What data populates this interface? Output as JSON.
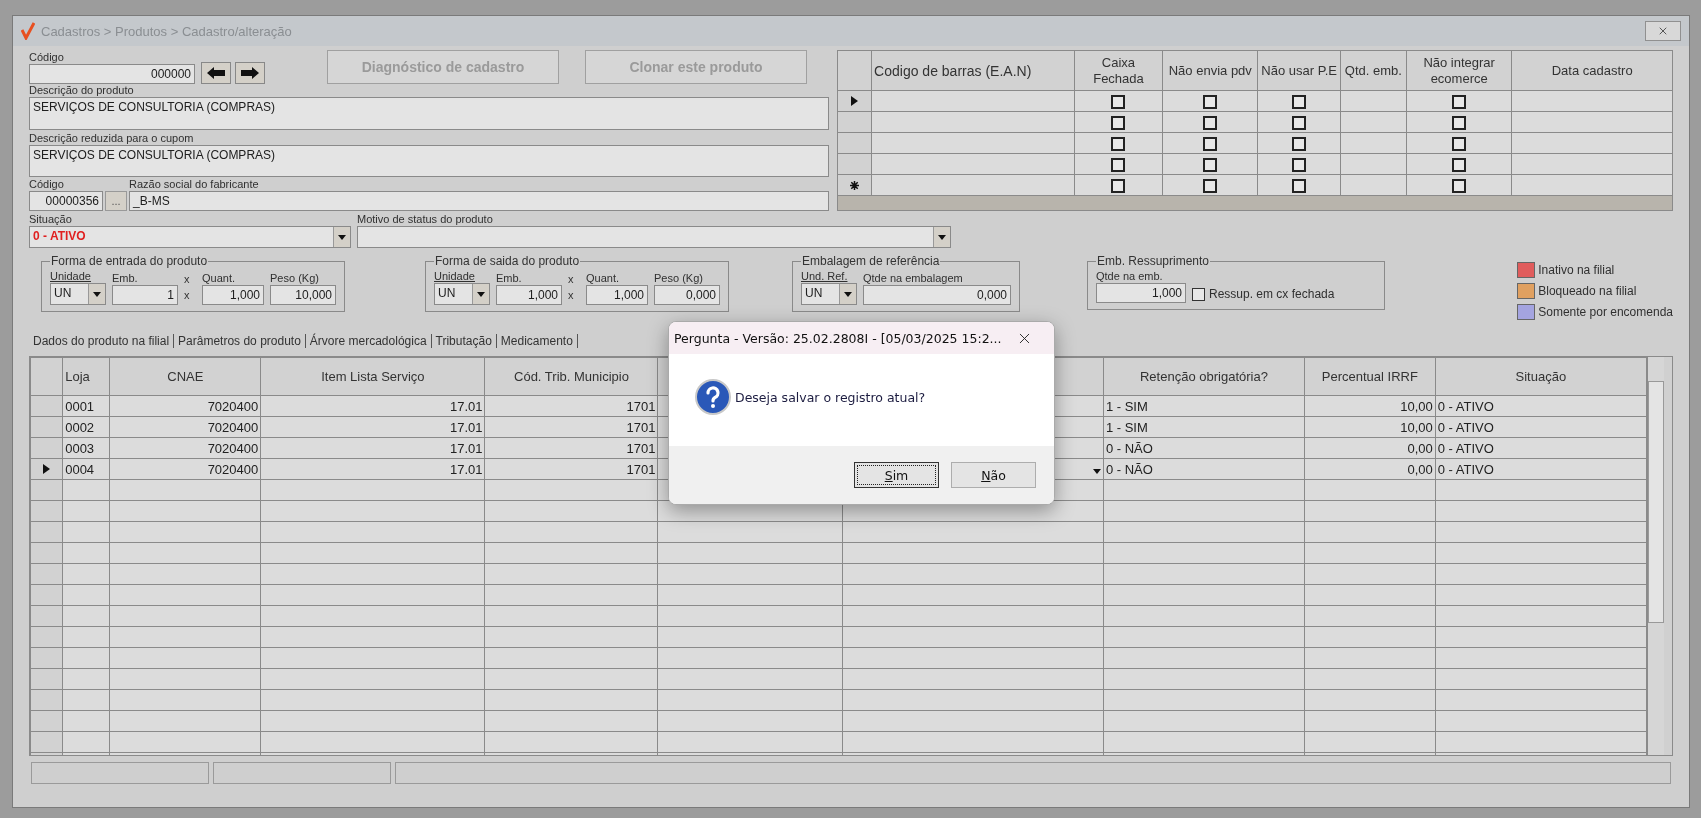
{
  "window": {
    "title": "Cadastros > Produtos > Cadastro/alteração"
  },
  "product": {
    "code_label": "Código",
    "code": "000000",
    "diagnose_button": "Diagnóstico de cadastro",
    "clone_button": "Clonar este produto",
    "description_label": "Descrição  do produto",
    "description": "SERVIÇOS DE CONSULTORIA (COMPRAS)",
    "short_label": "Descrição reduzida para o cupom",
    "short_description": "SERVIÇOS DE CONSULTORIA (COMPRAS)",
    "maker_code_label": "Código",
    "maker_code": "00000356",
    "maker_button": "...",
    "maker_name_label": "Razão social do fabricante",
    "maker_name": "_B-MS",
    "status_label": "Situação",
    "status": "0 - ATIVO",
    "reason_label": "Motivo de status do produto"
  },
  "barcodes": {
    "columns": [
      "Codigo de barras (E.A.N)",
      "Caixa Fechada",
      "Não envia pdv",
      "Não usar P.E",
      "Qtd. emb.",
      "Não integrar ecomerce",
      "Data cadastro"
    ],
    "rows": [
      {
        "kind": "current",
        "checks": [
          false,
          false,
          false,
          false
        ]
      },
      {
        "kind": "plain",
        "checks": [
          false,
          false,
          false,
          false
        ]
      },
      {
        "kind": "plain",
        "checks": [
          false,
          false,
          false,
          false
        ]
      },
      {
        "kind": "plain",
        "checks": [
          false,
          false,
          false,
          false
        ]
      },
      {
        "kind": "new",
        "checks": [
          false,
          false,
          false,
          false
        ]
      }
    ]
  },
  "entry": {
    "title": "Forma de entrada do produto",
    "unit_label": "Unidade",
    "unit": "UN",
    "emb_label": "Emb.",
    "emb": "1",
    "times_top": "x",
    "qty_label": "Quant.",
    "times": "x",
    "qty": "1,000",
    "weight_label": "Peso (Kg)",
    "weight": "10,000"
  },
  "exit": {
    "title": "Forma de saida do produto",
    "unit_label": "Unidade",
    "unit": "UN",
    "emb_label": "Emb.",
    "emb": "1,000",
    "times_top": "x",
    "qty_label": "Quant.",
    "times": "x",
    "qty": "1,000",
    "weight_label": "Peso (Kg)",
    "weight": "0,000"
  },
  "reference": {
    "title": "Embalagem de referência",
    "unit_label": "Und. Ref.",
    "unit": "UN",
    "qty_label": "Qtde na embalagem",
    "qty": "0,000"
  },
  "resupply": {
    "title": "Emb. Ressuprimento",
    "qty_label": "Qtde na emb.",
    "qty": "1,000",
    "closed_box_label": "Ressup. em cx fechada",
    "closed_box_checked": false
  },
  "legend": [
    {
      "label": "Inativo na filial",
      "color": "#e05c5c"
    },
    {
      "label": "Bloqueado na filial",
      "color": "#e0a060"
    },
    {
      "label": "Somente por encomenda",
      "color": "#a4a4e0"
    }
  ],
  "tabs": [
    "Dados do produto na filial",
    "Parâmetros do produto",
    "Árvore mercadológica",
    "Tributação",
    "Medicamento"
  ],
  "branches": {
    "columns": [
      "Loja",
      "CNAE",
      "Item Lista Serviço",
      "Cód. Trib. Municipio",
      "Retenção obrigatória?",
      "Percentual IRRF",
      "Situação"
    ],
    "rows": [
      {
        "current": false,
        "store": "0001",
        "cnae": "7020400",
        "service_item": "17.01",
        "municipal_code": "1701",
        "retention": "1 - SIM",
        "irrf": "10,00",
        "status": "0 - ATIVO"
      },
      {
        "current": false,
        "store": "0002",
        "cnae": "7020400",
        "service_item": "17.01",
        "municipal_code": "1701",
        "retention": "1 - SIM",
        "irrf": "10,00",
        "status": "0 - ATIVO"
      },
      {
        "current": false,
        "store": "0003",
        "cnae": "7020400",
        "service_item": "17.01",
        "municipal_code": "1701",
        "retention": "0 - NÃO",
        "irrf": "0,00",
        "status": "0 - ATIVO"
      },
      {
        "current": true,
        "store": "0004",
        "cnae": "7020400",
        "service_item": "17.01",
        "municipal_code": "1701",
        "retention": "0 - NÃO",
        "irrf": "0,00",
        "status": "0 - ATIVO"
      }
    ]
  },
  "dialog": {
    "title": "Pergunta - Versão: 25.02.2808I - [05/03/2025 15:2...",
    "message": "Deseja salvar o registro atual?",
    "buttons": [
      {
        "label": "Sim",
        "focused": true
      },
      {
        "label": "Não",
        "focused": false
      }
    ]
  }
}
